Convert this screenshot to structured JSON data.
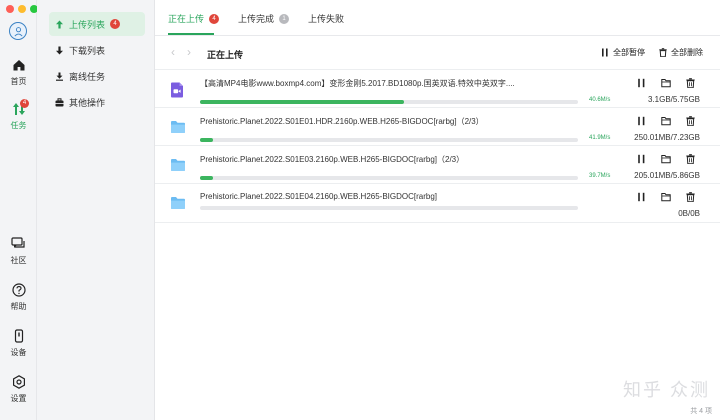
{
  "window": {
    "traffic_lights": [
      "#fe5f57",
      "#febc2e",
      "#28c840"
    ]
  },
  "rail": {
    "items": [
      {
        "label": "首页",
        "icon": "home-icon"
      },
      {
        "label": "任务",
        "icon": "transfer-icon",
        "badge": "4",
        "active": true
      },
      {
        "label": "社区",
        "icon": "chat-icon"
      },
      {
        "label": "帮助",
        "icon": "help-icon"
      },
      {
        "label": "设备",
        "icon": "device-icon"
      },
      {
        "label": "设置",
        "icon": "gear-icon"
      }
    ]
  },
  "subnav": {
    "items": [
      {
        "label": "上传列表",
        "badge": "4",
        "active": true,
        "icon": "upload-arrow-icon"
      },
      {
        "label": "下载列表",
        "icon": "download-arrow-icon"
      },
      {
        "label": "离线任务",
        "icon": "offline-download-icon"
      },
      {
        "label": "其他操作",
        "icon": "briefcase-icon"
      }
    ]
  },
  "tabs": [
    {
      "label": "正在上传",
      "badge": "4",
      "badge_color": "#e0463b",
      "active": true
    },
    {
      "label": "上传完成",
      "badge": "1",
      "badge_color": "#b8b9bd"
    },
    {
      "label": "上传失败"
    }
  ],
  "toolbar": {
    "title": "正在上传",
    "pause_all": "全部暂停",
    "delete_all": "全部删除"
  },
  "accent": "#2aa55c",
  "files": [
    {
      "name": "【高清MP4电影www.boxmp4.com】变形金刚5.2017.BD1080p.国英双语.特效中英双字....",
      "icon": "video-file-icon",
      "progress": 0.54,
      "speed": "40.6M/s",
      "size": "3.1GB/5.75GB"
    },
    {
      "name": "Prehistoric.Planet.2022.S01E01.HDR.2160p.WEB.H265-BIGDOC[rarbg]（2/3）",
      "icon": "folder-icon",
      "progress": 0.035,
      "speed": "41.9M/s",
      "size": "250.01MB/7.23GB"
    },
    {
      "name": "Prehistoric.Planet.2022.S01E03.2160p.WEB.H265-BIGDOC[rarbg]（2/3）",
      "icon": "folder-icon",
      "progress": 0.035,
      "speed": "39.7M/s",
      "size": "205.01MB/5.86GB"
    },
    {
      "name": "Prehistoric.Planet.2022.S01E04.2160p.WEB.H265-BIGDOC[rarbg]",
      "icon": "folder-icon",
      "progress": 0,
      "speed": "",
      "size": "0B/0B"
    }
  ],
  "footer": {
    "count": "共 4 项"
  },
  "watermark": "知乎 众测"
}
